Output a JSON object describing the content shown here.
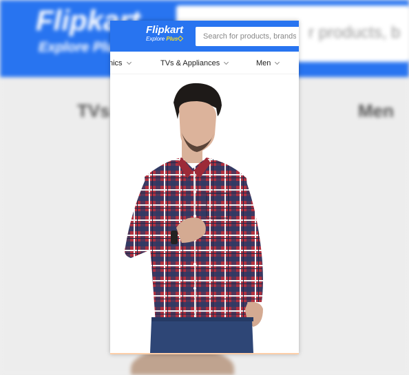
{
  "brand": {
    "name": "Flipkart",
    "tagline_prefix": "Explore",
    "tagline_plus": "Plus"
  },
  "search": {
    "placeholder": "Search for products, brands and more",
    "backdrop_text": "r products, b"
  },
  "nav": {
    "items": [
      {
        "label": "nics"
      },
      {
        "label": "TVs & Appliances"
      },
      {
        "label": "Men"
      }
    ],
    "backdrop_items": [
      "TVs",
      "Men"
    ]
  },
  "banner": {
    "subject": "model wearing red and navy checked full-sleeve shirt"
  },
  "colors": {
    "brand_blue": "#2874f0",
    "plus_yellow": "#ffe11b",
    "shirt_red": "#b0303f",
    "shirt_navy": "#2b3a66"
  }
}
